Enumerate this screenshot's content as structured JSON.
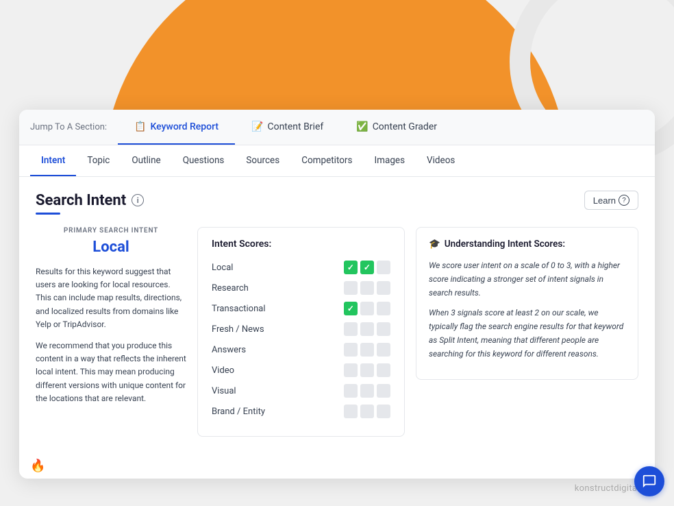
{
  "background": {
    "circle_color": "#F2922A"
  },
  "watermark": "konstructdigital.com",
  "top_nav": {
    "label": "Jump To A Section:",
    "tabs": [
      {
        "id": "keyword-report",
        "icon": "📋",
        "label": "Keyword Report",
        "active": true
      },
      {
        "id": "content-brief",
        "icon": "📝",
        "label": "Content Brief",
        "active": false
      },
      {
        "id": "content-grader",
        "icon": "✅",
        "label": "Content Grader",
        "active": false
      }
    ]
  },
  "secondary_tabs": {
    "tabs": [
      {
        "id": "intent",
        "label": "Intent",
        "active": true
      },
      {
        "id": "topic",
        "label": "Topic",
        "active": false
      },
      {
        "id": "outline",
        "label": "Outline",
        "active": false
      },
      {
        "id": "questions",
        "label": "Questions",
        "active": false
      },
      {
        "id": "sources",
        "label": "Sources",
        "active": false
      },
      {
        "id": "competitors",
        "label": "Competitors",
        "active": false
      },
      {
        "id": "images",
        "label": "Images",
        "active": false
      },
      {
        "id": "videos",
        "label": "Videos",
        "active": false
      }
    ]
  },
  "intent_section": {
    "title": "Search Intent",
    "learn_label": "Learn",
    "primary_search_intent_label": "PRIMARY SEARCH INTENT",
    "primary_intent": "Local",
    "description_1": "Results for this keyword suggest that users are looking for local resources. This can include map results, directions, and localized results from domains like Yelp or TripAdvisor.",
    "description_2": "We recommend that you produce this content in a way that reflects the inherent local intent. This may mean producing different versions with unique content for the locations that are relevant.",
    "intent_scores": {
      "title": "Intent Scores:",
      "rows": [
        {
          "label": "Local",
          "dots": [
            true,
            true,
            false
          ]
        },
        {
          "label": "Research",
          "dots": [
            false,
            false,
            false
          ]
        },
        {
          "label": "Transactional",
          "dots": [
            true,
            false,
            false
          ]
        },
        {
          "label": "Fresh / News",
          "dots": [
            false,
            false,
            false
          ]
        },
        {
          "label": "Answers",
          "dots": [
            false,
            false,
            false
          ]
        },
        {
          "label": "Video",
          "dots": [
            false,
            false,
            false
          ]
        },
        {
          "label": "Visual",
          "dots": [
            false,
            false,
            false
          ]
        },
        {
          "label": "Brand / Entity",
          "dots": [
            false,
            false,
            false
          ]
        }
      ]
    },
    "understanding": {
      "title": "Understanding Intent Scores:",
      "icon": "🎓",
      "paragraph_1": "We score user intent on a scale of 0 to 3, with a higher score indicating a stronger set of intent signals in search results.",
      "paragraph_2": "When 3 signals score at least 2 on our scale, we typically flag the search engine results for that keyword as Split Intent, meaning that different people are searching for this keyword for different reasons."
    }
  },
  "fire_icon": "🔥"
}
